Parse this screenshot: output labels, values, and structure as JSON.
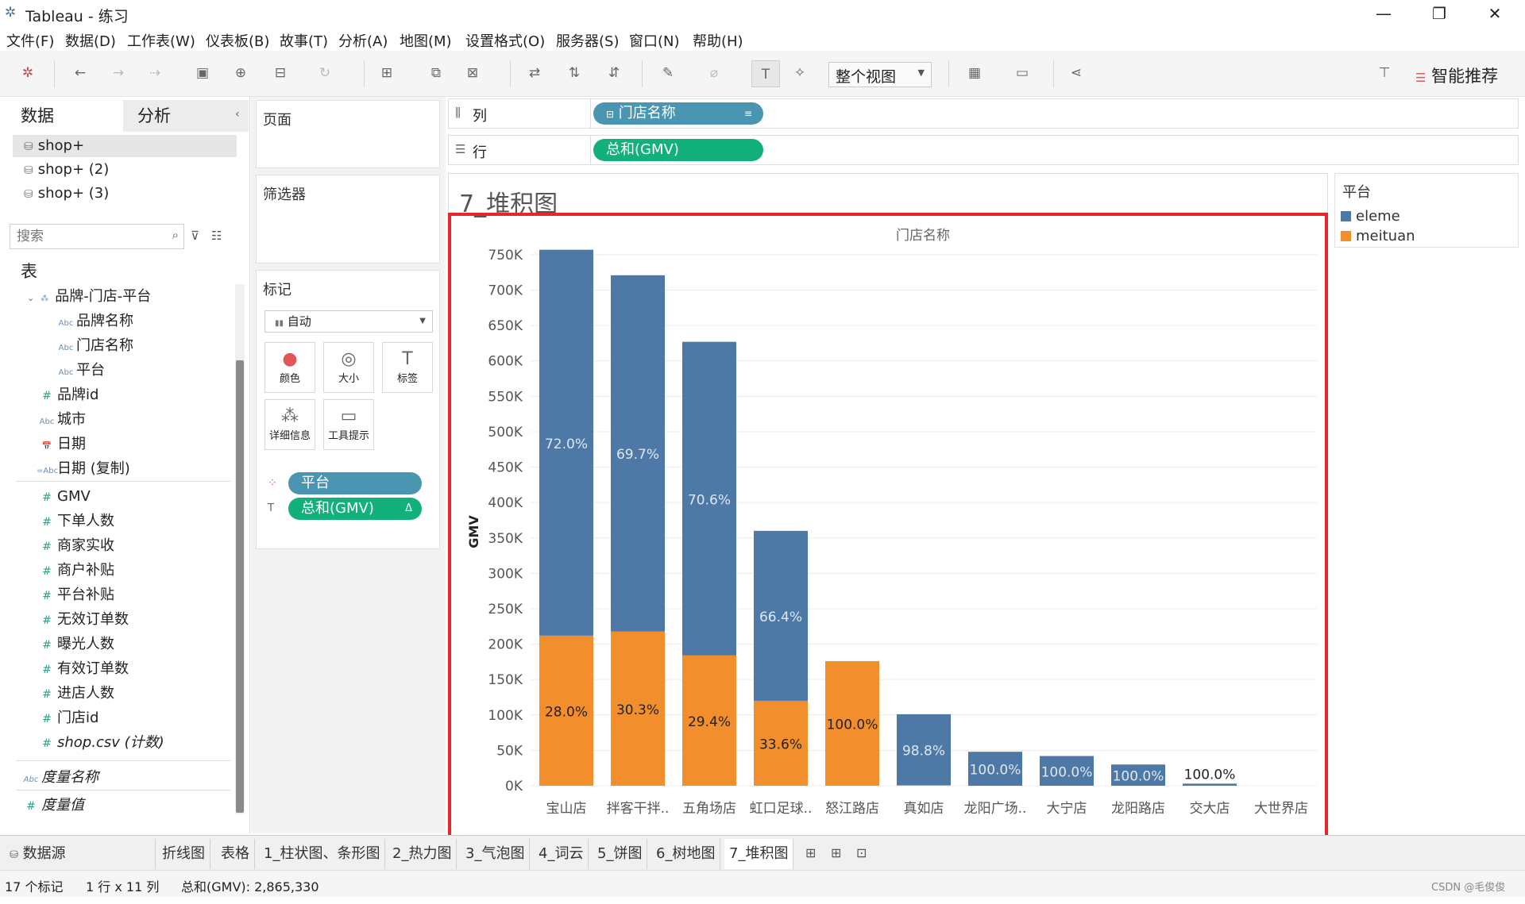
{
  "window": {
    "title": "Tableau - 练习",
    "minimize": "—",
    "maximize": "❐",
    "close": "✕"
  },
  "menu": [
    "文件(F)",
    "数据(D)",
    "工作表(W)",
    "仪表板(B)",
    "故事(T)",
    "分析(A)",
    "地图(M)",
    "设置格式(O)",
    "服务器(S)",
    "窗口(N)",
    "帮助(H)"
  ],
  "toolbar": {
    "view_mode": "整个视图",
    "recommend": "智能推荐"
  },
  "leftpane": {
    "tab_data": "数据",
    "tab_analysis": "分析",
    "datasources": [
      "shop+",
      "shop+ (2)",
      "shop+ (3)"
    ],
    "search_placeholder": "搜索",
    "section_tables": "表",
    "hierarchy": "品牌-门店-平台",
    "hierarchy_fields": [
      "品牌名称",
      "门店名称",
      "平台"
    ],
    "dim_fields": [
      {
        "type": "#",
        "name": "品牌id"
      },
      {
        "type": "Abc",
        "name": "城市"
      },
      {
        "type": "📅",
        "name": "日期"
      },
      {
        "type": "=Abc",
        "name": "日期 (复制)"
      }
    ],
    "mea_fields": [
      "GMV",
      "下单人数",
      "商家实收",
      "商户补贴",
      "平台补贴",
      "无效订单数",
      "曝光人数",
      "有效订单数",
      "进店人数",
      "门店id",
      "shop.csv (计数)"
    ],
    "measure_names": "度量名称",
    "measure_values": "度量值"
  },
  "shelves": {
    "pages": "页面",
    "filters": "筛选器",
    "marks": "标记",
    "marks_type": "自动",
    "mark_buttons": [
      "颜色",
      "大小",
      "标签",
      "详细信息",
      "工具提示"
    ],
    "mark_pills": [
      "平台",
      "总和(GMV)"
    ],
    "columns_label": "列",
    "rows_label": "行",
    "columns_pill": "门店名称",
    "rows_pill": "总和(GMV)"
  },
  "sheet": {
    "title": "7_堆积图"
  },
  "legend": {
    "title": "平台",
    "items": [
      {
        "name": "eleme",
        "color": "#4e79a7"
      },
      {
        "name": "meituan",
        "color": "#f28e2b"
      }
    ]
  },
  "chart_data": {
    "type": "bar",
    "stacked": true,
    "title": "门店名称",
    "xlabel": "",
    "ylabel": "GMV",
    "ylim": [
      0,
      760000
    ],
    "yticks": [
      "0K",
      "50K",
      "100K",
      "150K",
      "200K",
      "250K",
      "300K",
      "350K",
      "400K",
      "450K",
      "500K",
      "550K",
      "600K",
      "650K",
      "700K",
      "750K"
    ],
    "categories": [
      "宝山店",
      "拌客干拌..",
      "五角场店",
      "虹口足球..",
      "怒江路店",
      "真如店",
      "龙阳广场..",
      "大宁店",
      "龙阳路店",
      "交大店",
      "大世界店"
    ],
    "series": [
      {
        "name": "meituan",
        "color": "#f28e2b",
        "values": [
          212000,
          218000,
          184000,
          120000,
          176000,
          1000,
          0,
          0,
          0,
          0,
          0
        ],
        "labels": [
          "28.0%",
          "30.3%",
          "29.4%",
          "33.6%",
          "100.0%",
          "",
          "",
          "",
          "",
          "",
          ""
        ]
      },
      {
        "name": "eleme",
        "color": "#4e79a7",
        "values": [
          545000,
          503000,
          443000,
          240000,
          0,
          100000,
          48000,
          42000,
          30000,
          3000,
          0
        ],
        "labels": [
          "72.0%",
          "69.7%",
          "70.6%",
          "66.4%",
          "",
          "98.8%",
          "100.0%",
          "100.0%",
          "100.0%",
          "100.0%",
          ""
        ]
      }
    ]
  },
  "tabs": {
    "datasource": "数据源",
    "sheets": [
      "折线图",
      "表格",
      "1_柱状图、条形图",
      "2_热力图",
      "3_气泡图",
      "4_词云",
      "5_饼图",
      "6_树地图",
      "7_堆积图"
    ],
    "active": "7_堆积图"
  },
  "status": {
    "marks": "17 个标记",
    "dims": "1 行 x 11 列",
    "sum": "总和(GMV): 2,865,330",
    "watermark": "CSDN @毛俊俊"
  }
}
